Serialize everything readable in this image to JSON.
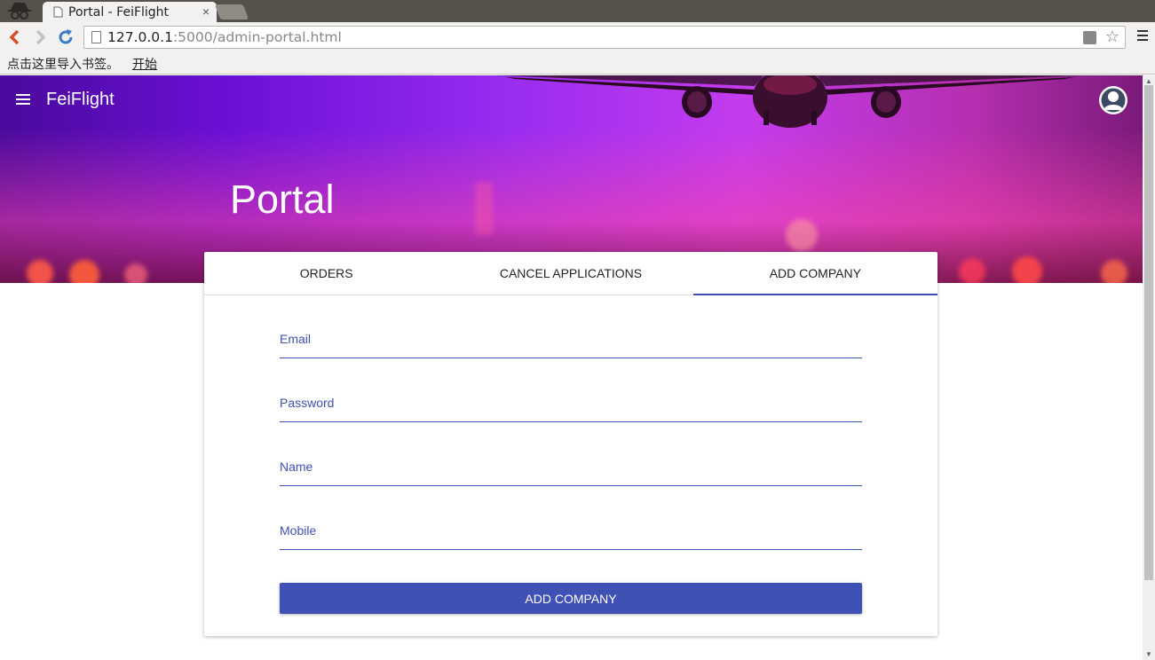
{
  "browser": {
    "tab_title": "Portal - FeiFlight",
    "tab_close": "×",
    "url_host": "127.0.0.1",
    "url_path": ":5000/admin-portal.html",
    "bookmarks_text": "点击这里导入书签。",
    "bookmarks_link": "开始"
  },
  "appbar": {
    "title": "FeiFlight"
  },
  "hero": {
    "title": "Portal"
  },
  "tabs": [
    {
      "label": "ORDERS"
    },
    {
      "label": "CANCEL APPLICATIONS"
    },
    {
      "label": "ADD COMPANY",
      "active": true
    }
  ],
  "form": {
    "fields": [
      {
        "label": "Email",
        "value": ""
      },
      {
        "label": "Password",
        "value": ""
      },
      {
        "label": "Name",
        "value": ""
      },
      {
        "label": "Mobile",
        "value": ""
      }
    ],
    "submit_label": "ADD COMPANY"
  },
  "colors": {
    "accent": "#3f51b5",
    "chrome_dark": "#55524c",
    "chrome_light": "#f2f1f0"
  }
}
